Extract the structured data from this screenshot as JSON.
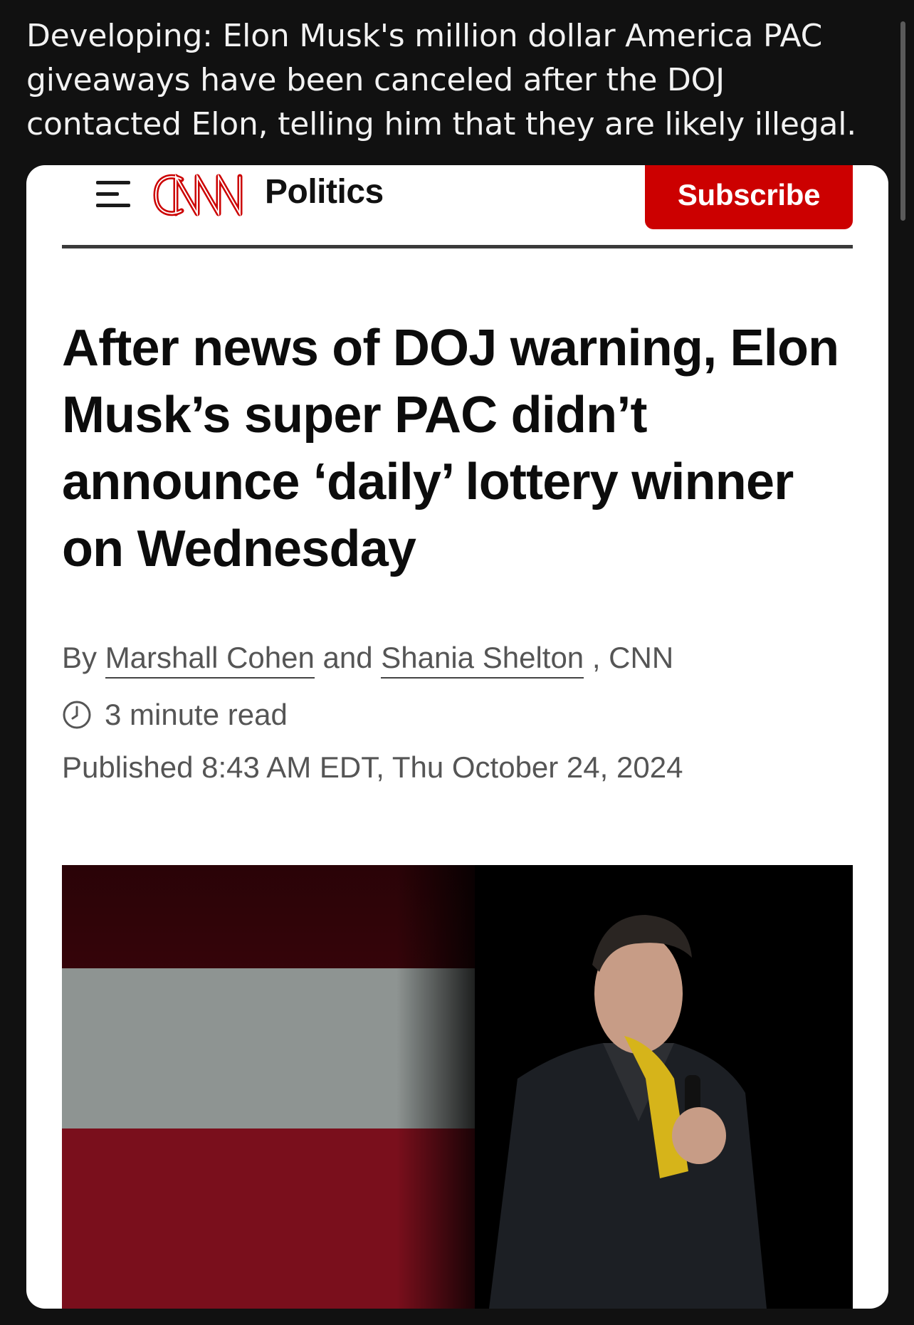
{
  "post": {
    "text": "Developing: Elon Musk's million dollar America PAC giveaways have been canceled after the DOJ contacted Elon, telling him that they are likely illegal."
  },
  "article": {
    "brand": "CNN",
    "section": "Politics",
    "subscribe_label": "Subscribe",
    "headline": "After news of DOJ warning, Elon Musk’s super PAC didn’t announce ‘daily’ lottery winner on Wednesday",
    "byline": {
      "prefix": "By ",
      "author1": "Marshall Cohen",
      "joiner": " and ",
      "author2": "Shania Shelton",
      "suffix": ", CNN"
    },
    "read_time": "3 minute read",
    "published": "Published 8:43 AM EDT, Thu October 24, 2024"
  },
  "colors": {
    "brand_red": "#cc0000",
    "page_bg": "#111111",
    "card_bg": "#ffffff"
  },
  "icons": [
    "hamburger-menu-icon",
    "cnn-logo",
    "clock-icon"
  ]
}
